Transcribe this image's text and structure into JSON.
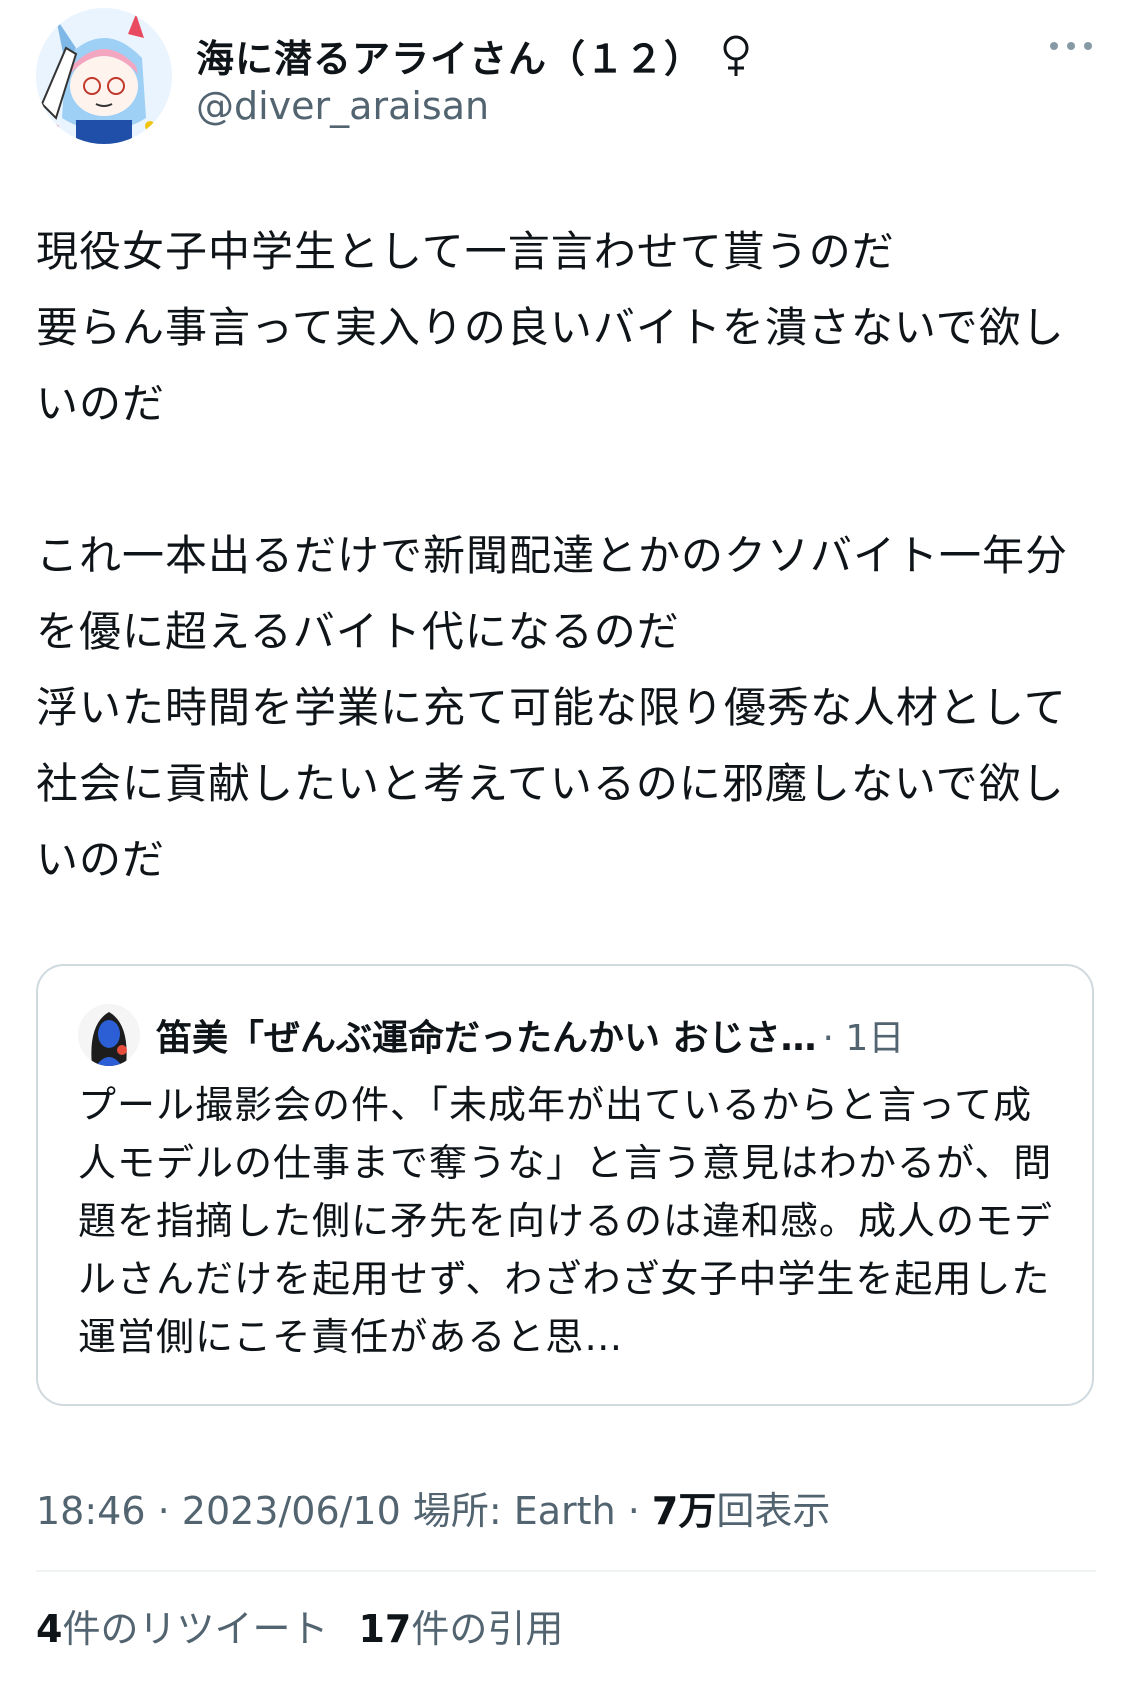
{
  "author": {
    "display_name": "海に潜るアライさん（１２）",
    "handle": "@diver_araisan",
    "avatar_icon": "avatar-anime-character",
    "gender_icon": "female-sign-icon"
  },
  "tweet": {
    "paragraphs": [
      "現役女子中学生として一言言わせて貰うのだ\n要らん事言って実入りの良いバイトを潰さないで欲しいのだ",
      "これ一本出るだけで新聞配達とかのクソバイト一年分を優に超えるバイト代になるのだ\n浮いた時間を学業に充て可能な限り優秀な人材として社会に貢献したいと考えているのに邪魔しないで欲しいのだ"
    ]
  },
  "quote": {
    "author_name": "笛美「ぜんぶ運命だったんかい おじさ…",
    "time": "· 1日",
    "text": "プール撮影会の件、「未成年が出ているからと言って成人モデルの仕事まで奪うな」と言う意見はわかるが、問題を指摘した側に矛先を向けるのは違和感。成人のモデルさんだけを起用せず、わざわざ女子中学生を起用した運営側にこそ責任があると思…"
  },
  "meta": {
    "time": "18:46",
    "sep1": " · ",
    "date": "2023/06/10",
    "location_label": " 場所: ",
    "location": "Earth",
    "sep2": " · ",
    "views_count": "7万",
    "views_label": "回表示"
  },
  "stats": {
    "retweets_count": "4",
    "retweets_label": "件のリツイート",
    "quotes_count": "17",
    "quotes_label": "件の引用"
  },
  "colors": {
    "text_primary": "#0f1419",
    "text_secondary": "#536471",
    "border": "#cfd9de"
  }
}
